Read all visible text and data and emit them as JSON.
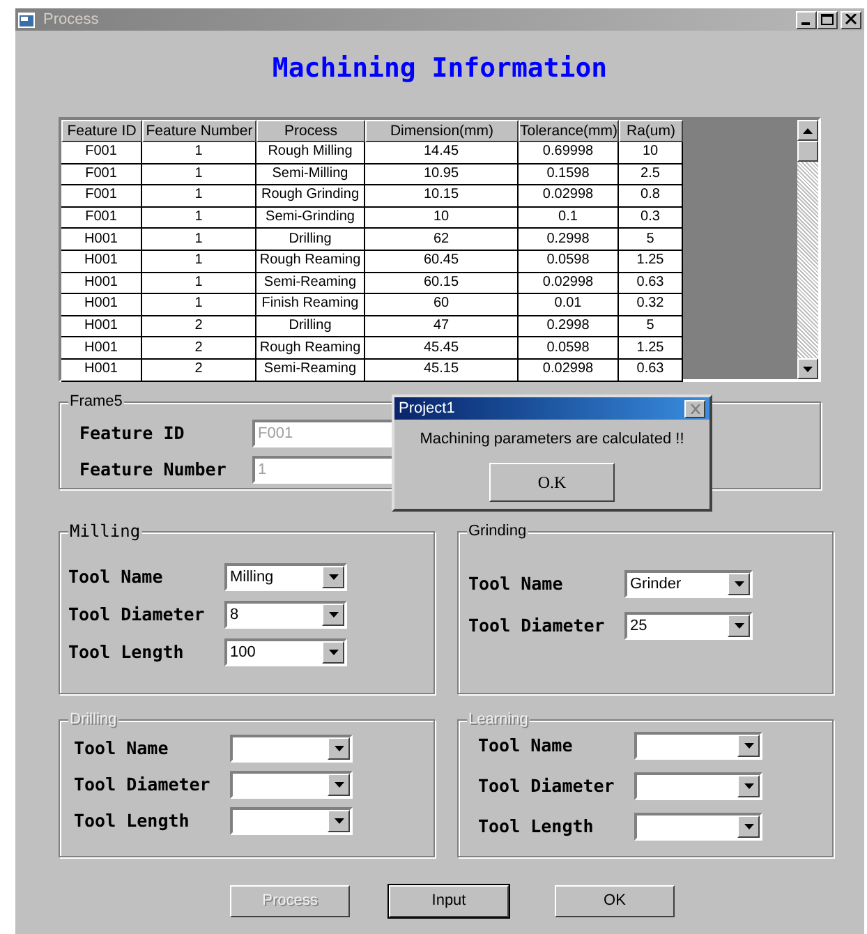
{
  "window": {
    "title": "Process"
  },
  "heading": "Machining Information",
  "table": {
    "columns": [
      "Feature ID",
      "Feature Number",
      "Process",
      "Dimension(mm)",
      "Tolerance(mm)",
      "Ra(um)"
    ],
    "rows": [
      [
        "F001",
        "1",
        "Rough Milling",
        "14.45",
        "0.69998",
        "10"
      ],
      [
        "F001",
        "1",
        "Semi-Milling",
        "10.95",
        "0.1598",
        "2.5"
      ],
      [
        "F001",
        "1",
        "Rough Grinding",
        "10.15",
        "0.02998",
        "0.8"
      ],
      [
        "F001",
        "1",
        "Semi-Grinding",
        "10",
        "0.1",
        "0.3"
      ],
      [
        "H001",
        "1",
        "Drilling",
        "62",
        "0.2998",
        "5"
      ],
      [
        "H001",
        "1",
        "Rough Reaming",
        "60.45",
        "0.0598",
        "1.25"
      ],
      [
        "H001",
        "1",
        "Semi-Reaming",
        "60.15",
        "0.02998",
        "0.63"
      ],
      [
        "H001",
        "1",
        "Finish Reaming",
        "60",
        "0.01",
        "0.32"
      ],
      [
        "H001",
        "2",
        "Drilling",
        "47",
        "0.2998",
        "5"
      ],
      [
        "H001",
        "2",
        "Rough Reaming",
        "45.45",
        "0.0598",
        "1.25"
      ],
      [
        "H001",
        "2",
        "Semi-Reaming",
        "45.15",
        "0.02998",
        "0.63"
      ]
    ]
  },
  "frame": {
    "title": "Frame5",
    "fields": [
      {
        "label": "Feature ID",
        "value": "F001",
        "disabled": true
      },
      {
        "label": "Feature Number",
        "value": "1",
        "disabled": true
      }
    ]
  },
  "groups": [
    {
      "title": "Milling",
      "disabled": false,
      "fields": [
        {
          "label": "Tool Name",
          "value": "Milling"
        },
        {
          "label": "Tool Diameter",
          "value": "8"
        },
        {
          "label": "Tool Length",
          "value": "100"
        }
      ]
    },
    {
      "title": "Grinding",
      "disabled": false,
      "fields": [
        {
          "label": "Tool Name",
          "value": "Grinder"
        },
        {
          "label": "Tool Diameter",
          "value": "25"
        }
      ]
    },
    {
      "title": "Drilling",
      "disabled": true,
      "fields": [
        {
          "label": "Tool Name"
        },
        {
          "label": "Tool Diameter"
        },
        {
          "label": "Tool Length"
        }
      ]
    },
    {
      "title": "Learning",
      "disabled": true,
      "fields": [
        {
          "label": "Tool Name"
        },
        {
          "label": "Tool Diameter"
        },
        {
          "label": "Tool Length"
        }
      ]
    }
  ],
  "dialog": {
    "title": "Project1",
    "message": "Machining parameters are calculated !!",
    "button": "O.K"
  },
  "buttons": [
    {
      "label": "Process",
      "disabled": true
    },
    {
      "label": "Input",
      "disabled": false
    },
    {
      "label": "OK",
      "disabled": false
    }
  ]
}
